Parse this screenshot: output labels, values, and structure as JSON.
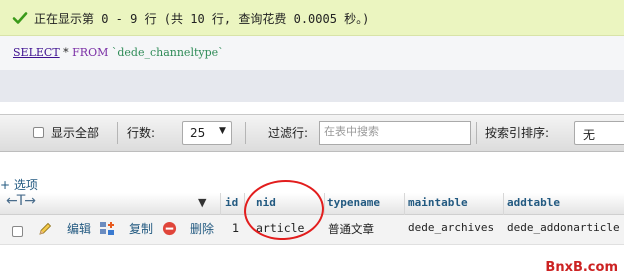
{
  "success": {
    "message": "正在显示第 0 - 9 行 (共 10 行, 查询花费 0.0005 秒。)",
    "icon": "check-icon"
  },
  "sql": {
    "select": "SELECT",
    "star": " * ",
    "from": "FROM",
    "table": " `dede_channeltype`"
  },
  "toolbar": {
    "show_all": "显示全部",
    "rows_label": "行数:",
    "rows_value": "25",
    "filter_label": "过滤行:",
    "filter_placeholder": "在表中搜索",
    "sort_label": "按索引排序:",
    "sort_value": "无"
  },
  "options_link": "+ 选项",
  "table": {
    "columns": [
      "id",
      "nid",
      "typename",
      "maintable",
      "addtable"
    ],
    "rows": [
      {
        "actions": {
          "edit": "编辑",
          "copy": "复制",
          "delete": "删除"
        },
        "id": "1",
        "nid": "article",
        "typename": "普通文章",
        "maintable": "dede_archives",
        "addtable": "dede_addonarticle"
      }
    ]
  },
  "watermark": "BnxB.com",
  "colors": {
    "success_bg": "#ebf5c0",
    "link": "#235a81",
    "highlight_circle": "#e21d1d"
  }
}
